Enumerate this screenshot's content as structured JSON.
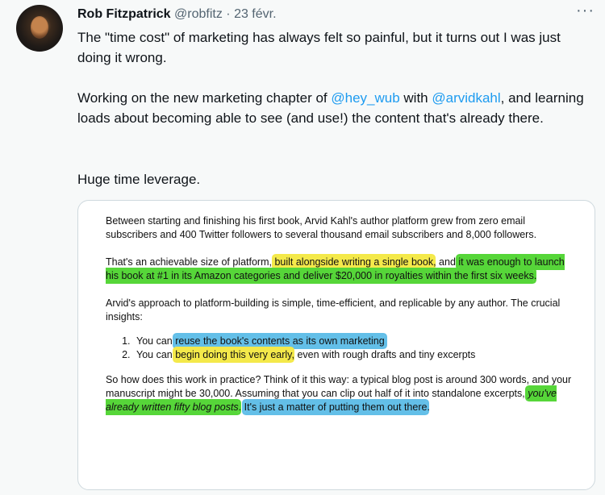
{
  "author": {
    "name": "Rob Fitzpatrick",
    "handle": "@robfitz",
    "separator": "·",
    "date": "23 févr.",
    "more": "···"
  },
  "tweet": {
    "p1": "The \"time cost\" of marketing has always felt so painful, but it turns out I was just doing it wrong.",
    "p2_a": "Working on the new marketing chapter of ",
    "p2_m1": "@hey_wub",
    "p2_b": " with ",
    "p2_m2": "@arvidkahl",
    "p2_c": ", and learning loads about becoming able to see (and use!) the content that's already there.",
    "p3": "Huge time leverage."
  },
  "excerpt": {
    "para1": "Between starting and finishing his first book, Arvid Kahl's author platform grew from zero email subscribers and 400 Twitter followers to several thousand email subscribers and 8,000 followers.",
    "para2_a": "That's an achievable size of platform, ",
    "para2_hl_yellow": "built alongside writing a single book",
    "para2_b": ", and ",
    "para2_hl_green": "it was enough to launch his book at #1 in its Amazon categories and deliver $20,000 in royalties within the first six weeks",
    "para2_c": ".",
    "para3": "Arvid's approach to platform-building is simple, time-efficient, and replicable by any author. The crucial insights:",
    "list": [
      {
        "prefix": "You can ",
        "highlight": "reuse the book's contents as its own marketing",
        "suffix": ""
      },
      {
        "prefix": "You can ",
        "highlight": "begin doing this very early",
        "suffix": ", even with rough drafts and tiny excerpts"
      }
    ],
    "para4_a": "So how does this work in practice? Think of it this way: a typical blog post is around 300 words, and your manuscript might be 30,000. Assuming that you can clip out half of it into standalone excerpts, ",
    "para4_hl_green": "you've already written fifty blog posts",
    "para4_b": ". ",
    "para4_hl_blue": "It's just a matter of putting them out there",
    "para4_c": "."
  },
  "colors": {
    "highlight_yellow": "#f4e94a",
    "highlight_green": "#56d639",
    "highlight_blue": "#63bfe8",
    "mention": "#1d9bf0"
  }
}
